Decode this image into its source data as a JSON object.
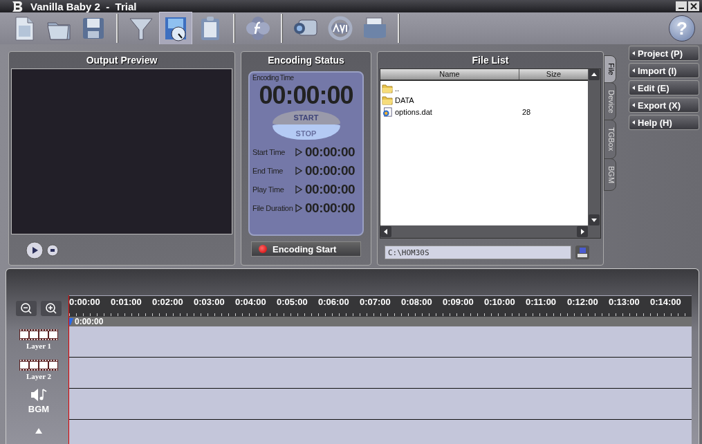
{
  "window": {
    "title": "Vanilla Baby 2  -  Trial"
  },
  "toolbar": {
    "buttons": [
      {
        "kind": "new",
        "selected": false
      },
      {
        "kind": "open",
        "selected": false
      },
      {
        "kind": "save",
        "selected": false
      },
      {
        "kind": "filter",
        "selected": false
      },
      {
        "kind": "encode",
        "selected": true
      },
      {
        "kind": "clipboard",
        "selected": false
      },
      {
        "kind": "effects",
        "selected": false
      },
      {
        "kind": "camera",
        "selected": false
      },
      {
        "kind": "avi",
        "selected": false
      },
      {
        "kind": "archive",
        "selected": false
      }
    ],
    "help": "?"
  },
  "output_preview": {
    "title": "Output Preview"
  },
  "encoding_status": {
    "title": "Encoding Status",
    "time_label": "Encoding Time",
    "time": "00:00:00",
    "start": "START",
    "stop": "STOP",
    "rows": [
      {
        "label": "Start Time",
        "value": "00:00:00"
      },
      {
        "label": "End Time",
        "value": "00:00:00"
      },
      {
        "label": "Play Time",
        "value": "00:00:00"
      },
      {
        "label": "File Duration",
        "value": "00:00:00"
      }
    ],
    "button": "Encoding Start"
  },
  "file_list": {
    "title": "File List",
    "columns": [
      "Name",
      "Size"
    ],
    "rows": [
      {
        "kind": "folder",
        "name": ".."
      },
      {
        "kind": "folder",
        "name": "DATA"
      },
      {
        "kind": "file",
        "name": "options.dat",
        "size": "28"
      }
    ],
    "path": "C:\\HOM30S"
  },
  "side_tabs": [
    {
      "label": "File",
      "selected": true
    },
    {
      "label": "Device",
      "selected": false
    },
    {
      "label": "TGBox",
      "selected": false
    },
    {
      "label": "BGM",
      "selected": false
    }
  ],
  "menu": [
    "Project (P)",
    "Import (I)",
    "Edit (E)",
    "Export (X)",
    "Help (H)"
  ],
  "timeline": {
    "ruler": [
      "0:00:00",
      "0:01:00",
      "0:02:00",
      "0:03:00",
      "0:04:00",
      "0:05:00",
      "0:06:00",
      "0:07:00",
      "0:08:00",
      "0:09:00",
      "0:10:00",
      "0:11:00",
      "0:12:00",
      "0:13:00",
      "0:14:00"
    ],
    "playhead": "0:00:00",
    "tracks": [
      {
        "kind": "video",
        "label": "Layer 1"
      },
      {
        "kind": "video",
        "label": "Layer 2"
      },
      {
        "kind": "audio",
        "label": "BGM"
      },
      {
        "kind": "text"
      }
    ]
  }
}
